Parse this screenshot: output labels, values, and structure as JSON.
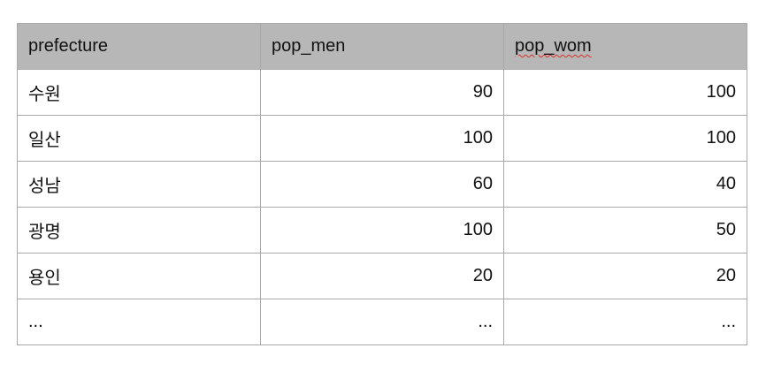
{
  "table": {
    "headers": [
      "prefecture",
      "pop_men",
      "pop_wom"
    ],
    "rows": [
      [
        "수원",
        "90",
        "100"
      ],
      [
        "일산",
        "100",
        "100"
      ],
      [
        "성남",
        "60",
        "40"
      ],
      [
        "광명",
        "100",
        "50"
      ],
      [
        "용인",
        "20",
        "20"
      ],
      [
        "...",
        "...",
        "..."
      ]
    ]
  },
  "colors": {
    "header_background": "#b7b7b7",
    "border": "#a9a9a9",
    "spellcheck_underline": "#d93025"
  }
}
